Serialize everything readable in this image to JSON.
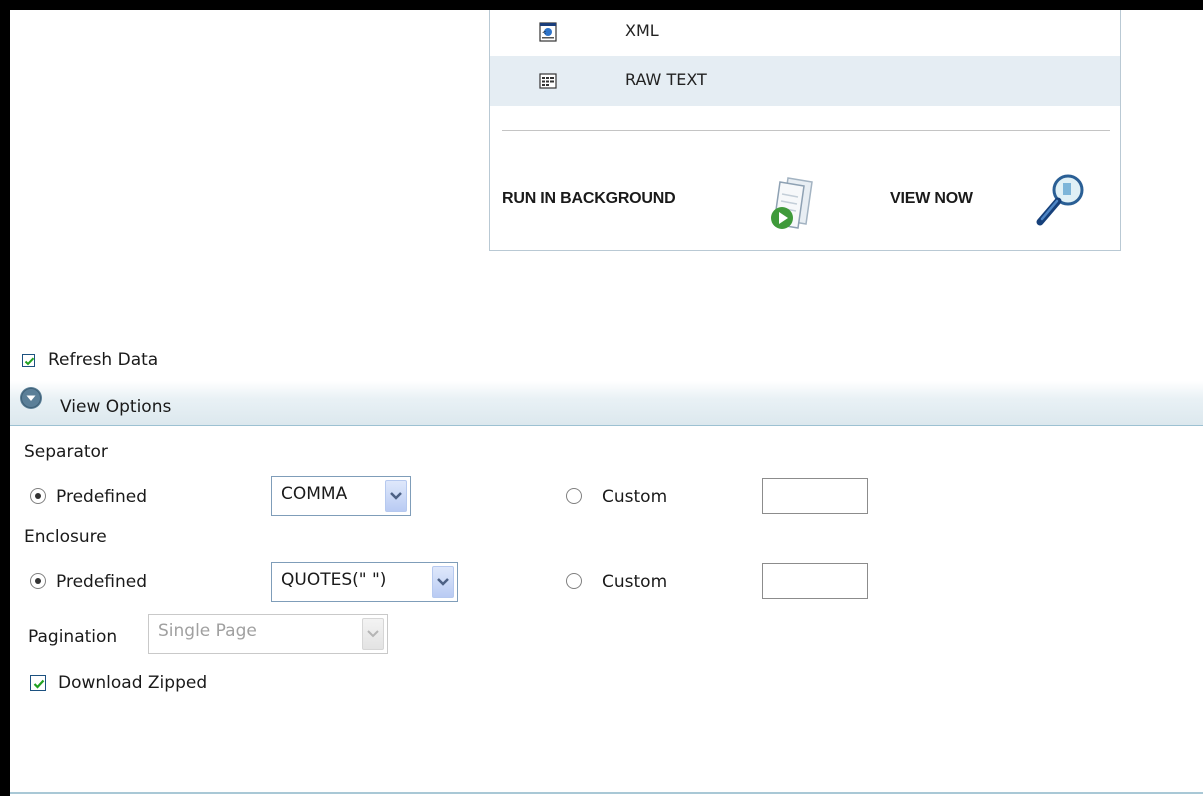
{
  "export": {
    "formats": [
      {
        "label": "XML",
        "icon": "xml-file-icon"
      },
      {
        "label": "RAW TEXT",
        "icon": "raw-text-file-icon",
        "selected": true
      }
    ],
    "run_in_background_label": "RUN IN BACKGROUND",
    "view_now_label": "VIEW NOW"
  },
  "refresh": {
    "label": "Refresh Data",
    "checked": true
  },
  "view_options": {
    "title": "View Options",
    "separator": {
      "heading": "Separator",
      "predefined_label": "Predefined",
      "predefined_selected": true,
      "predefined_value": "COMMA",
      "custom_label": "Custom",
      "custom_value": ""
    },
    "enclosure": {
      "heading": "Enclosure",
      "predefined_label": "Predefined",
      "predefined_selected": true,
      "predefined_value": "QUOTES(\" \")",
      "custom_label": "Custom",
      "custom_value": ""
    },
    "pagination": {
      "label": "Pagination",
      "value": "Single Page",
      "disabled": true
    },
    "download_zipped": {
      "label": "Download Zipped",
      "checked": true
    }
  },
  "colors": {
    "accent": "#1c5180",
    "highlight_row": "#e5edf3",
    "header_border": "#9cc1d2"
  }
}
